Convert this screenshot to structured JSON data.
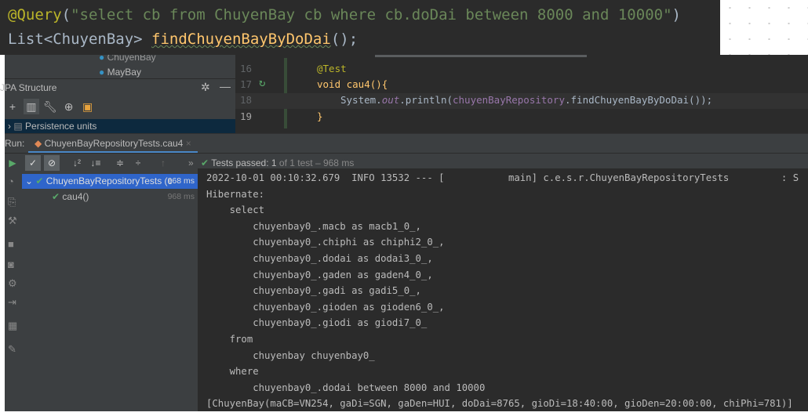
{
  "snippet": {
    "annotation": "@Query",
    "open": "(",
    "query": "\"select cb from ChuyenBay cb where cb.doDai between 8000 and 10000\"",
    "close": ")",
    "line2_type": "List<ChuyenBay> ",
    "line2_method": "findChuyenBayByDoDai",
    "line2_end": "();"
  },
  "project_tree": {
    "items": [
      "ChuyenBay",
      "MayBay"
    ]
  },
  "jpa": {
    "title": "JPA Structure",
    "persistence": "Persistence units"
  },
  "editor": {
    "lines": [
      {
        "n": "16",
        "code": "@Test"
      },
      {
        "n": "17",
        "code": "void cau4(){"
      },
      {
        "n": "18",
        "pre": "System.",
        "out": "out",
        "mid": ".println(",
        "ref": "chuyenBayRepository",
        "post": ".findChuyenBayByDoDai());"
      },
      {
        "n": "19",
        "code": "}"
      }
    ]
  },
  "run": {
    "label": "Run:",
    "tab": "ChuyenBayRepositoryTests.cau4"
  },
  "status": {
    "passed": "Tests passed: ",
    "count": "1",
    "rest": " of 1 test – 968 ms"
  },
  "tree": {
    "root": "ChuyenBayRepositoryTests (c",
    "root_time": "968 ms",
    "child": "cau4()",
    "child_time": "968 ms"
  },
  "console": {
    "lines": [
      "2022-10-01 00:10:32.679  INFO 13532 --- [           main] c.e.s.r.ChuyenBayRepositoryTests         : S",
      "Hibernate: ",
      "    select",
      "        chuyenbay0_.macb as macb1_0_,",
      "        chuyenbay0_.chiphi as chiphi2_0_,",
      "        chuyenbay0_.dodai as dodai3_0_,",
      "        chuyenbay0_.gaden as gaden4_0_,",
      "        chuyenbay0_.gadi as gadi5_0_,",
      "        chuyenbay0_.gioden as gioden6_0_,",
      "        chuyenbay0_.giodi as giodi7_0_ ",
      "    from",
      "        chuyenbay chuyenbay0_ ",
      "    where",
      "        chuyenbay0_.dodai between 8000 and 10000",
      "[ChuyenBay(maCB=VN254, gaDi=SGN, gaDen=HUI, doDai=8765, gioDi=18:40:00, gioDen=20:00:00, chiPhi=781)]"
    ]
  }
}
